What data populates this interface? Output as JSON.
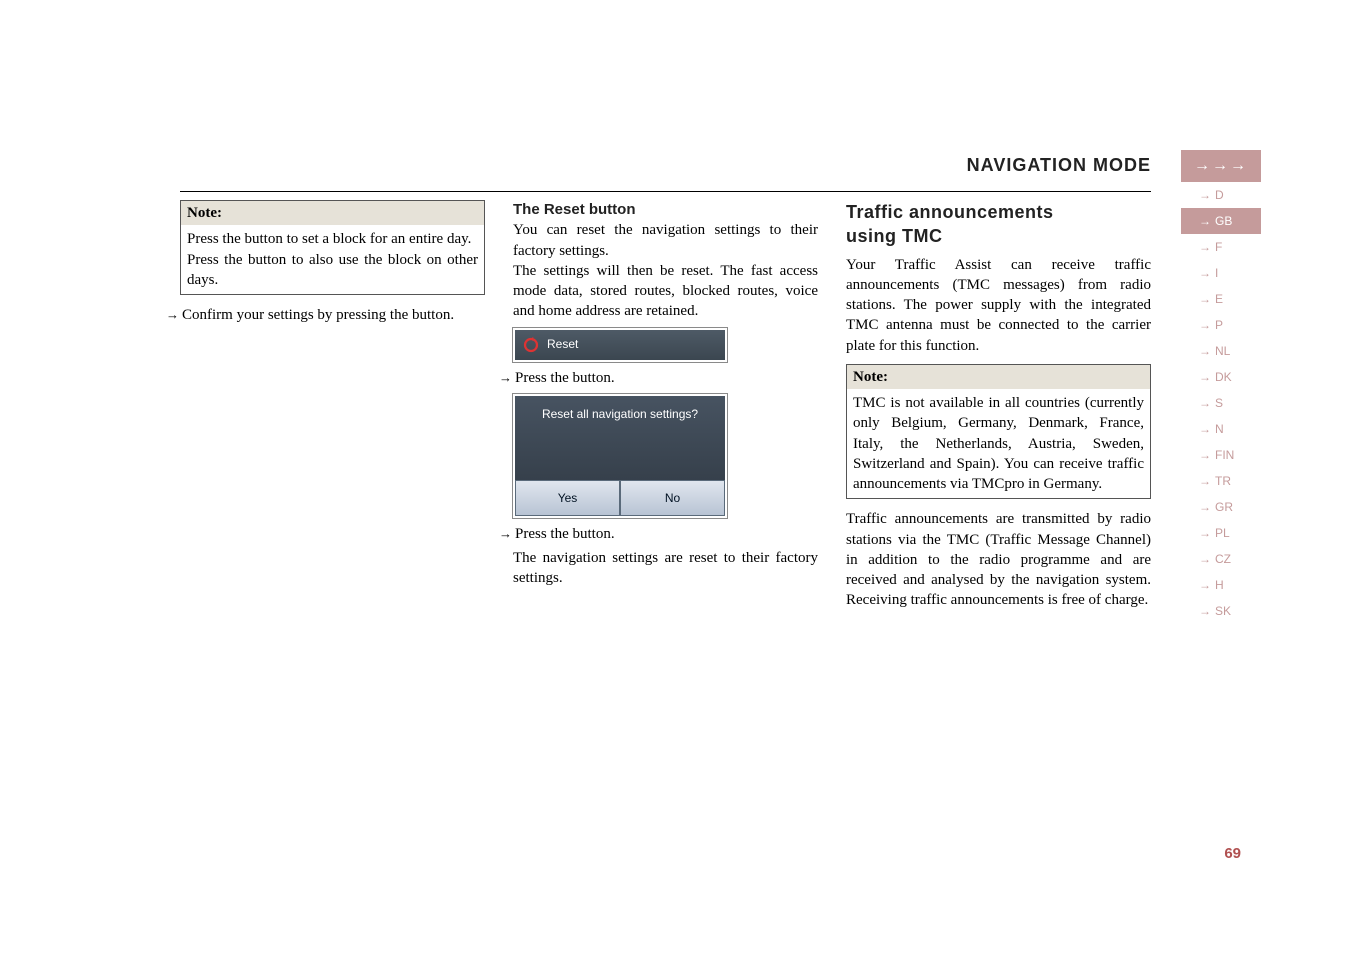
{
  "header": {
    "title": "NAVIGATION MODE",
    "arrows": "→→→"
  },
  "col1": {
    "note_label": "Note:",
    "note_line1a": "Press the ",
    "note_line1b": " button to set a block for an entire day.",
    "note_line2a": "Press the ",
    "note_line2b": " button to also use the block on other days.",
    "step_a": "Confirm your settings by pressing the ",
    "step_b": " button."
  },
  "col2": {
    "heading": "The Reset button",
    "p1": "You can reset the navigation settings to their factory settings.",
    "p2": "The settings will then be reset. The fast access mode data, stored routes, blocked routes, voice and home address are retained.",
    "shot_reset_label": "Reset",
    "step1_a": "Press the ",
    "step1_b": " button.",
    "dialog_msg": "Reset all navigation settings?",
    "dialog_yes": "Yes",
    "dialog_no": "No",
    "step2_a": "Press the ",
    "step2_b": " button.",
    "p3": "The navigation settings are reset to their factory settings."
  },
  "col3": {
    "heading1": "Traffic announcements",
    "heading2": "using TMC",
    "p1": "Your Traffic Assist can receive traffic announcements (TMC messages) from radio stations. The power supply with the integrated TMC antenna must be connected to the carrier plate for this function.",
    "note_label": "Note:",
    "note_body": "TMC is not available in all countries (currently only Belgium, Germany, Denmark, France, Italy, the Netherlands, Austria, Sweden, Switzerland and Spain). You can receive traffic announcements via TMCpro in Germany.",
    "p2": "Traffic announcements are transmitted by radio stations via the TMC (Traffic Message Channel) in addition to the radio programme and are received and analysed by the navigation system. Receiving traffic announcements is free of charge."
  },
  "langs": [
    "D",
    "GB",
    "F",
    "I",
    "E",
    "P",
    "NL",
    "DK",
    "S",
    "N",
    "FIN",
    "TR",
    "GR",
    "PL",
    "CZ",
    "H",
    "SK"
  ],
  "active_lang_index": 1,
  "page_number": "69"
}
